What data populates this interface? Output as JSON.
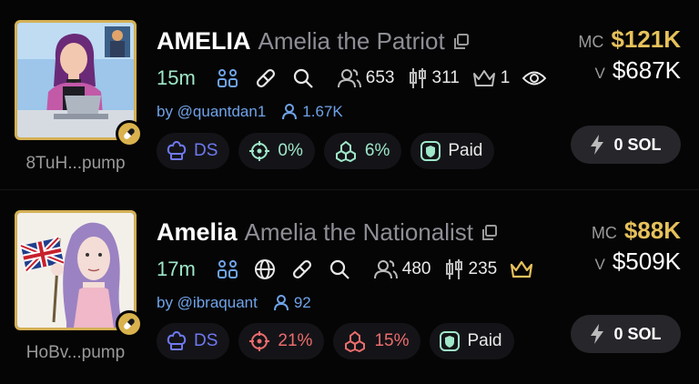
{
  "colors": {
    "gold": "#e6c15b",
    "green": "#9fe7c9",
    "blue": "#6fa3e8",
    "red": "#ec6d6d",
    "ds": "#6f79f0",
    "muted": "#8e8e96"
  },
  "tokens": [
    {
      "ticker": "AMELIA",
      "name": "Amelia the Patriot",
      "address": "8TuH...pump",
      "age": "15m",
      "holders": "653",
      "pro_traders": "311",
      "kol_count": "1",
      "creator": "by @quantdan1",
      "followers": "1.67K",
      "dev_sold": "DS",
      "top10": "0%",
      "snipers": "6%",
      "dex_paid": "Paid",
      "mc_label": "MC",
      "market_cap": "$121K",
      "v_label": "V",
      "volume": "$687K",
      "buy_label": "0 SOL"
    },
    {
      "ticker": "Amelia",
      "name": "Amelia the Nationalist",
      "address": "HoBv...pump",
      "age": "17m",
      "holders": "480",
      "pro_traders": "235",
      "creator": "by @ibraquant",
      "followers": "92",
      "dev_sold": "DS",
      "top10": "21%",
      "snipers": "15%",
      "dex_paid": "Paid",
      "mc_label": "MC",
      "market_cap": "$88K",
      "v_label": "V",
      "volume": "$509K",
      "buy_label": "0 SOL"
    }
  ]
}
